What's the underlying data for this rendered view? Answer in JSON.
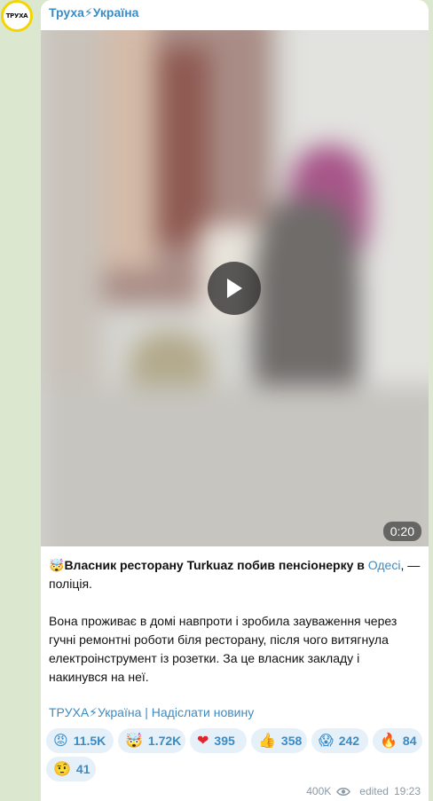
{
  "channel": {
    "avatar_text": "ТРУХА",
    "name": "Труха⚡Україна"
  },
  "video": {
    "duration": "0:20"
  },
  "post": {
    "emoji": "🤯",
    "headline_bold": "Власник ресторану Turkuaz побив пенсіонерку в ",
    "headline_link": "Одесі",
    "headline_tail": ", — поліція.",
    "body": "Вона проживає в домі навпроти і зробила зауваження через гучні ремонтні роботи біля ресторану, після чого витягнула електроінструмент із розетки. За це власник закладу і накинувся на неї.",
    "footer_channel": "ТРУХА⚡Україна",
    "footer_sep": " | ",
    "footer_submit": "Надіслати новину"
  },
  "reactions": [
    {
      "emoji": "😡",
      "count": "11.5K"
    },
    {
      "emoji": "🤯",
      "count": "1.72K"
    },
    {
      "emoji": "❤",
      "count": "395"
    },
    {
      "emoji": "👍",
      "count": "358"
    },
    {
      "emoji": "😱",
      "count": "242"
    },
    {
      "emoji": "🔥",
      "count": "84"
    },
    {
      "emoji": "🤨",
      "count": "41"
    }
  ],
  "meta": {
    "views": "400K",
    "edited": "edited",
    "time": "19:23"
  },
  "colors": {
    "accent": "#3a8cc6",
    "background": "#dbe7cf",
    "avatar_ring": "#f3d600"
  }
}
